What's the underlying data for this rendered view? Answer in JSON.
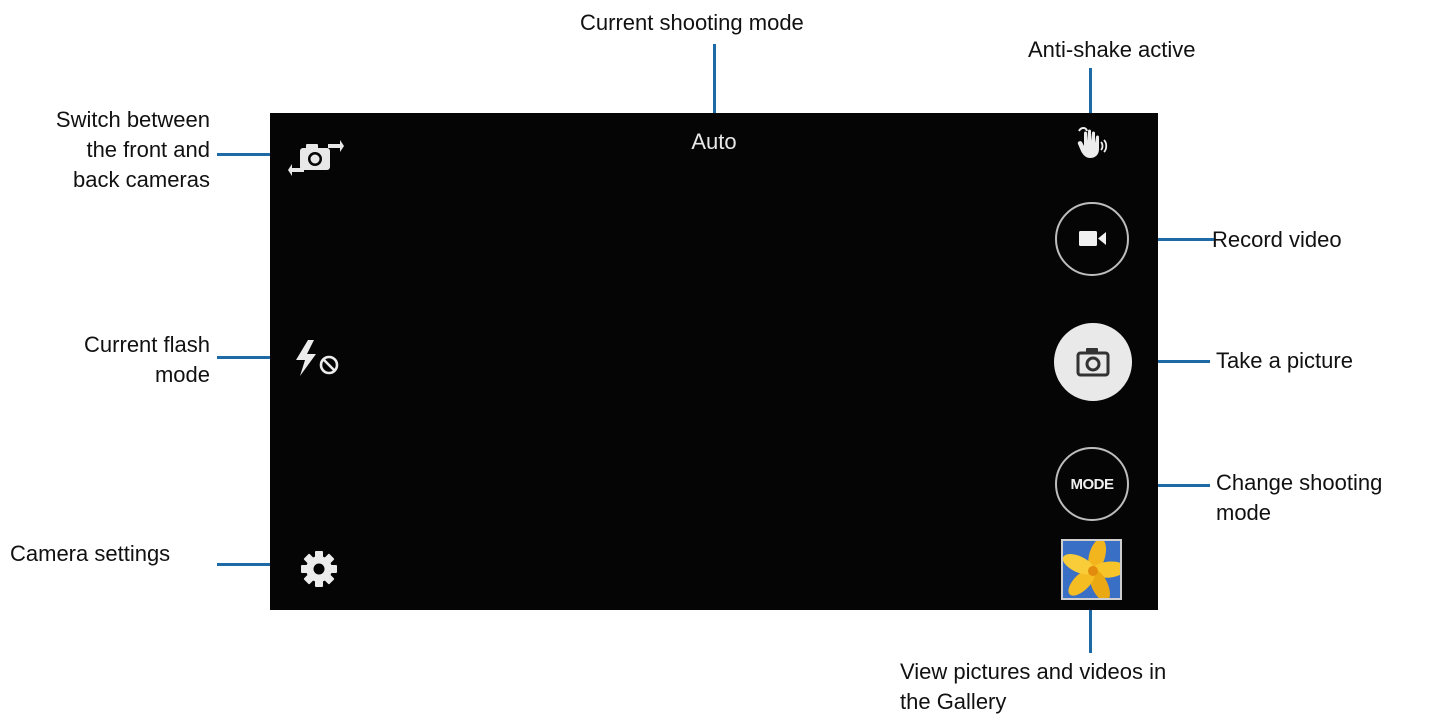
{
  "callouts": {
    "current_shooting_mode": "Current shooting mode",
    "anti_shake": "Anti-shake active",
    "switch_cameras_line1": "Switch between",
    "switch_cameras_line2": "the front and",
    "switch_cameras_line3": "back cameras",
    "record_video": "Record video",
    "current_flash_line1": "Current flash",
    "current_flash_line2": "mode",
    "take_picture": "Take a picture",
    "change_mode_line1": "Change shooting",
    "change_mode_line2": "mode",
    "camera_settings": "Camera settings",
    "gallery_line1": "View pictures and videos in",
    "gallery_line2": "the Gallery"
  },
  "camera": {
    "mode_text": "Auto",
    "mode_button_label": "MODE"
  },
  "icons": {
    "switch_camera": "switch-camera-icon",
    "flash_off": "flash-off-icon",
    "settings": "gear-icon",
    "anti_shake": "anti-shake-hand-icon",
    "video": "video-camera-icon",
    "shutter": "camera-icon",
    "gallery": "gallery-thumbnail"
  },
  "colors": {
    "leader_line": "#1e6aa6",
    "screen_bg": "#050505"
  }
}
